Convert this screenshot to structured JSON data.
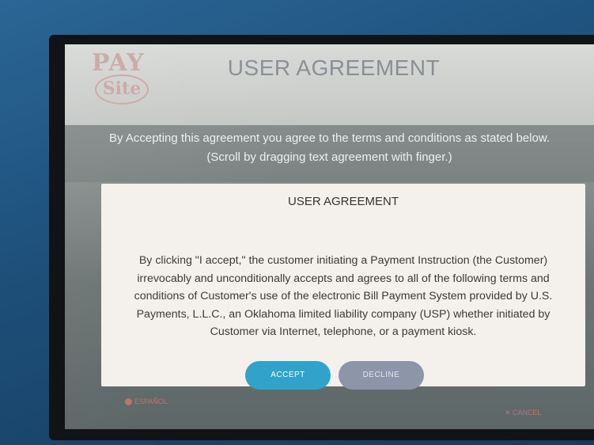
{
  "header": {
    "logo_top": "PAY",
    "logo_bottom": "Site",
    "title": "USER AGREEMENT"
  },
  "notice": {
    "line1": "By Accepting this agreement you agree to the terms and conditions as stated below.",
    "line2": "(Scroll by dragging text agreement with finger.)"
  },
  "agreement": {
    "heading": "USER AGREEMENT",
    "body_lines": [
      "By clicking \"I accept,\" the customer initiating a Payment Instruction (the Customer)",
      "irrevocably and unconditionally accepts and agrees to all of the following terms and",
      "conditions of Customer's use of the electronic Bill Payment System provided by U.S.",
      "Payments, L.L.C., an Oklahoma limited liability company (USP) whether initiated by",
      "Customer via Internet, telephone, or a payment kiosk."
    ]
  },
  "buttons": {
    "accept_label": "ACCEPT",
    "decline_label": "DECLINE"
  },
  "footer": {
    "left_label": "ESPAÑOL",
    "right_label": "✕ CANCEL"
  },
  "colors": {
    "accept_button": "#2fa3c9",
    "decline_button": "#8d96a9",
    "kiosk_housing": "#1d4e78"
  }
}
